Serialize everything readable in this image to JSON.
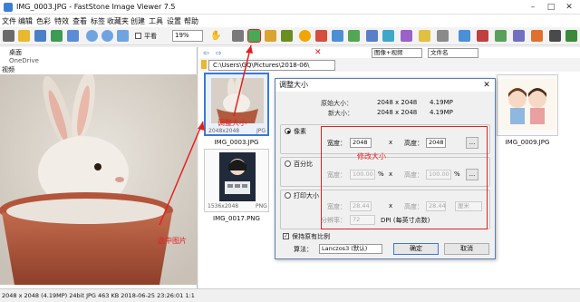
{
  "window": {
    "title": "IMG_0003.JPG - FastStone Image Viewer 7.5"
  },
  "menu": [
    "文件",
    "编辑",
    "色彩",
    "特效",
    "查看",
    "标签",
    "收藏夹",
    "创建",
    "工具",
    "设置",
    "帮助"
  ],
  "toolbar": {
    "zoom": "19%",
    "fit_label": "平看",
    "sort_option": "文件名",
    "view_option": "图像+视频"
  },
  "tree": {
    "item1": "桌面",
    "item2": "OneDrive",
    "item3": "视频"
  },
  "path": {
    "value": "C:\\Users\\GQ\\Pictures\\2018-06\\"
  },
  "thumbnails": [
    {
      "name": "IMG_0003.JPG",
      "info": "2048x2048",
      "format": "JPG"
    },
    {
      "name": "IMG_0017.PNG",
      "info": "1536x2048",
      "format": "PNG"
    },
    {
      "name": "IMG_0009.JPG",
      "info": ""
    }
  ],
  "status": {
    "text": "2048 x 2048 (4.19MP)   24bit   JPG   463 KB   2018-06-25 23:26:01   1:1"
  },
  "annotations": {
    "select_image": "选中图片",
    "resize": "调整大小",
    "modify_size": "修改大小"
  },
  "dialog": {
    "title": "调整大小",
    "orig_label": "原始大小：",
    "orig_dims": "2048 x 2048",
    "orig_mp": "4.19MP",
    "new_label": "新大小：",
    "new_dims": "2048 x 2048",
    "new_mp": "4.19MP",
    "pixel_label": "像素",
    "width_label": "宽度：",
    "height_label": "高度：",
    "pixel_width": "2048",
    "pixel_height": "2048",
    "times": "x",
    "more_btn": "...",
    "percent_label": "百分比",
    "percent_w": "100.00",
    "percent_h": "100.00",
    "pct": "%",
    "print_label": "打印大小",
    "print_w": "28.44",
    "print_h": "28.44",
    "print_unit": "厘米",
    "resolution_label": "分辨率：",
    "resolution": "72",
    "dpi_label": "DPI (每英寸点数)",
    "keep_ratio": "保持原有比例",
    "algo_label": "算法：",
    "algo": "Lanczos3 (默认)",
    "ok": "确定",
    "cancel": "取消"
  }
}
